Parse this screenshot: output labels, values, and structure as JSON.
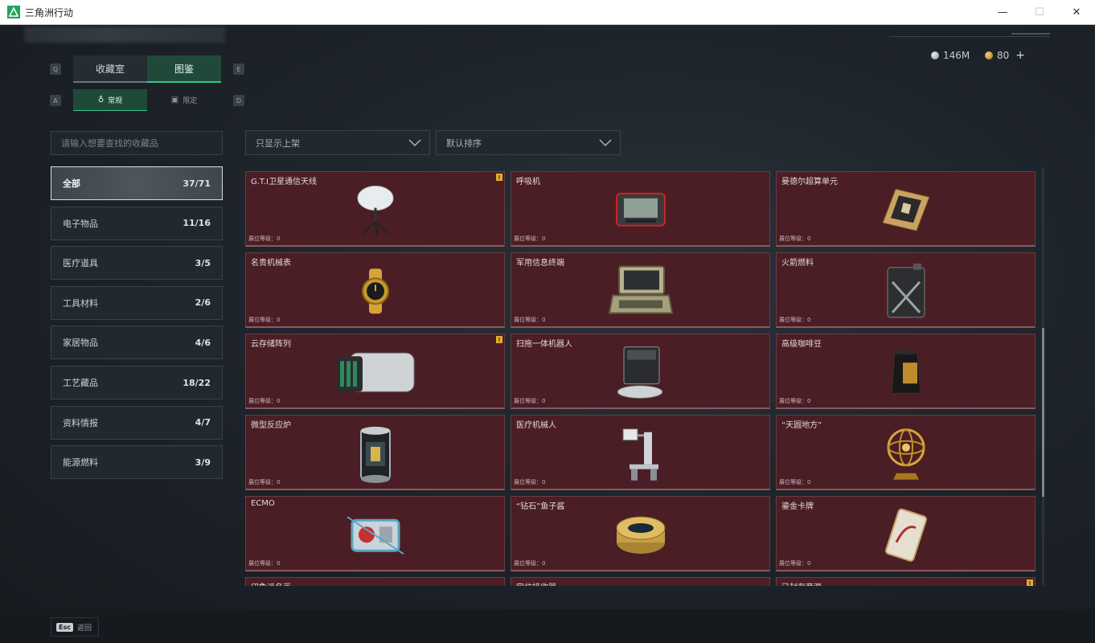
{
  "window": {
    "title": "三角洲行动",
    "controls": {
      "minimize": "—",
      "maximize": "☐",
      "close": "✕"
    }
  },
  "currency": [
    {
      "value": "146M",
      "color": "#b9bfc5",
      "icon": "coin-silver-icon"
    },
    {
      "value": "80",
      "color": "#d9a640",
      "icon": "coin-gold-icon"
    }
  ],
  "currency_plus": "+",
  "keyhints": {
    "q": "Q",
    "e": "E",
    "a": "A",
    "d": "D"
  },
  "tabs": [
    {
      "label": "收藏室",
      "active": false
    },
    {
      "label": "图鉴",
      "active": true
    }
  ],
  "subtabs": [
    {
      "label": "常规",
      "icon": "flask-icon",
      "active": true
    },
    {
      "label": "限定",
      "icon": "image-icon",
      "active": false
    }
  ],
  "search": {
    "placeholder": "请输入想要查找的收藏品"
  },
  "filters": {
    "shelf": "只显示上架",
    "sort": "默认排序"
  },
  "categories": [
    {
      "label": "全部",
      "count": "37/71",
      "active": true
    },
    {
      "label": "电子物品",
      "count": "11/16"
    },
    {
      "label": "医疗道具",
      "count": "3/5"
    },
    {
      "label": "工具材料",
      "count": "2/6"
    },
    {
      "label": "家居物品",
      "count": "4/6"
    },
    {
      "label": "工艺藏品",
      "count": "18/22"
    },
    {
      "label": "资料情报",
      "count": "4/7"
    },
    {
      "label": "能源燃料",
      "count": "3/9"
    }
  ],
  "level_label": "展位等级：0",
  "items": [
    {
      "name": "G.T.I卫星通信天线",
      "warn": true,
      "icon": "satellite-dish-icon"
    },
    {
      "name": "呼吸机",
      "warn": false,
      "icon": "ventilator-icon"
    },
    {
      "name": "曼德尔超算单元",
      "warn": false,
      "icon": "computing-unit-icon"
    },
    {
      "name": "名贵机械表",
      "warn": false,
      "icon": "watch-icon"
    },
    {
      "name": "军用信息终端",
      "warn": false,
      "icon": "military-terminal-icon"
    },
    {
      "name": "火箭燃料",
      "warn": false,
      "icon": "fuel-canister-icon"
    },
    {
      "name": "云存储阵列",
      "warn": true,
      "icon": "storage-array-icon"
    },
    {
      "name": "扫拖一体机器人",
      "warn": false,
      "icon": "robot-vacuum-icon"
    },
    {
      "name": "高级咖啡豆",
      "warn": false,
      "icon": "coffee-bag-icon"
    },
    {
      "name": "微型反应炉",
      "warn": false,
      "icon": "reactor-icon"
    },
    {
      "name": "医疗机械人",
      "warn": false,
      "icon": "medical-robot-icon"
    },
    {
      "name": "“天圆地方”",
      "warn": false,
      "icon": "armillary-sphere-icon"
    },
    {
      "name": "ECMO",
      "warn": false,
      "icon": "ecmo-machine-icon"
    },
    {
      "name": "“钻石”鱼子酱",
      "warn": false,
      "icon": "caviar-tin-icon"
    },
    {
      "name": "鎏金卡牌",
      "warn": false,
      "icon": "gold-card-icon"
    },
    {
      "name": "印象派名画",
      "warn": false,
      "icon": "painting-icon"
    },
    {
      "name": "定位接收器",
      "warn": false,
      "icon": "gps-receiver-icon"
    },
    {
      "name": "已封存音源",
      "warn": true,
      "icon": "sealed-audio-icon"
    }
  ],
  "bottom": {
    "esc_key": "Esc",
    "esc_label": "返回"
  },
  "colors": {
    "accent": "#36c88a",
    "card_bg": "#4a1e24",
    "warn": "#e0b030"
  }
}
